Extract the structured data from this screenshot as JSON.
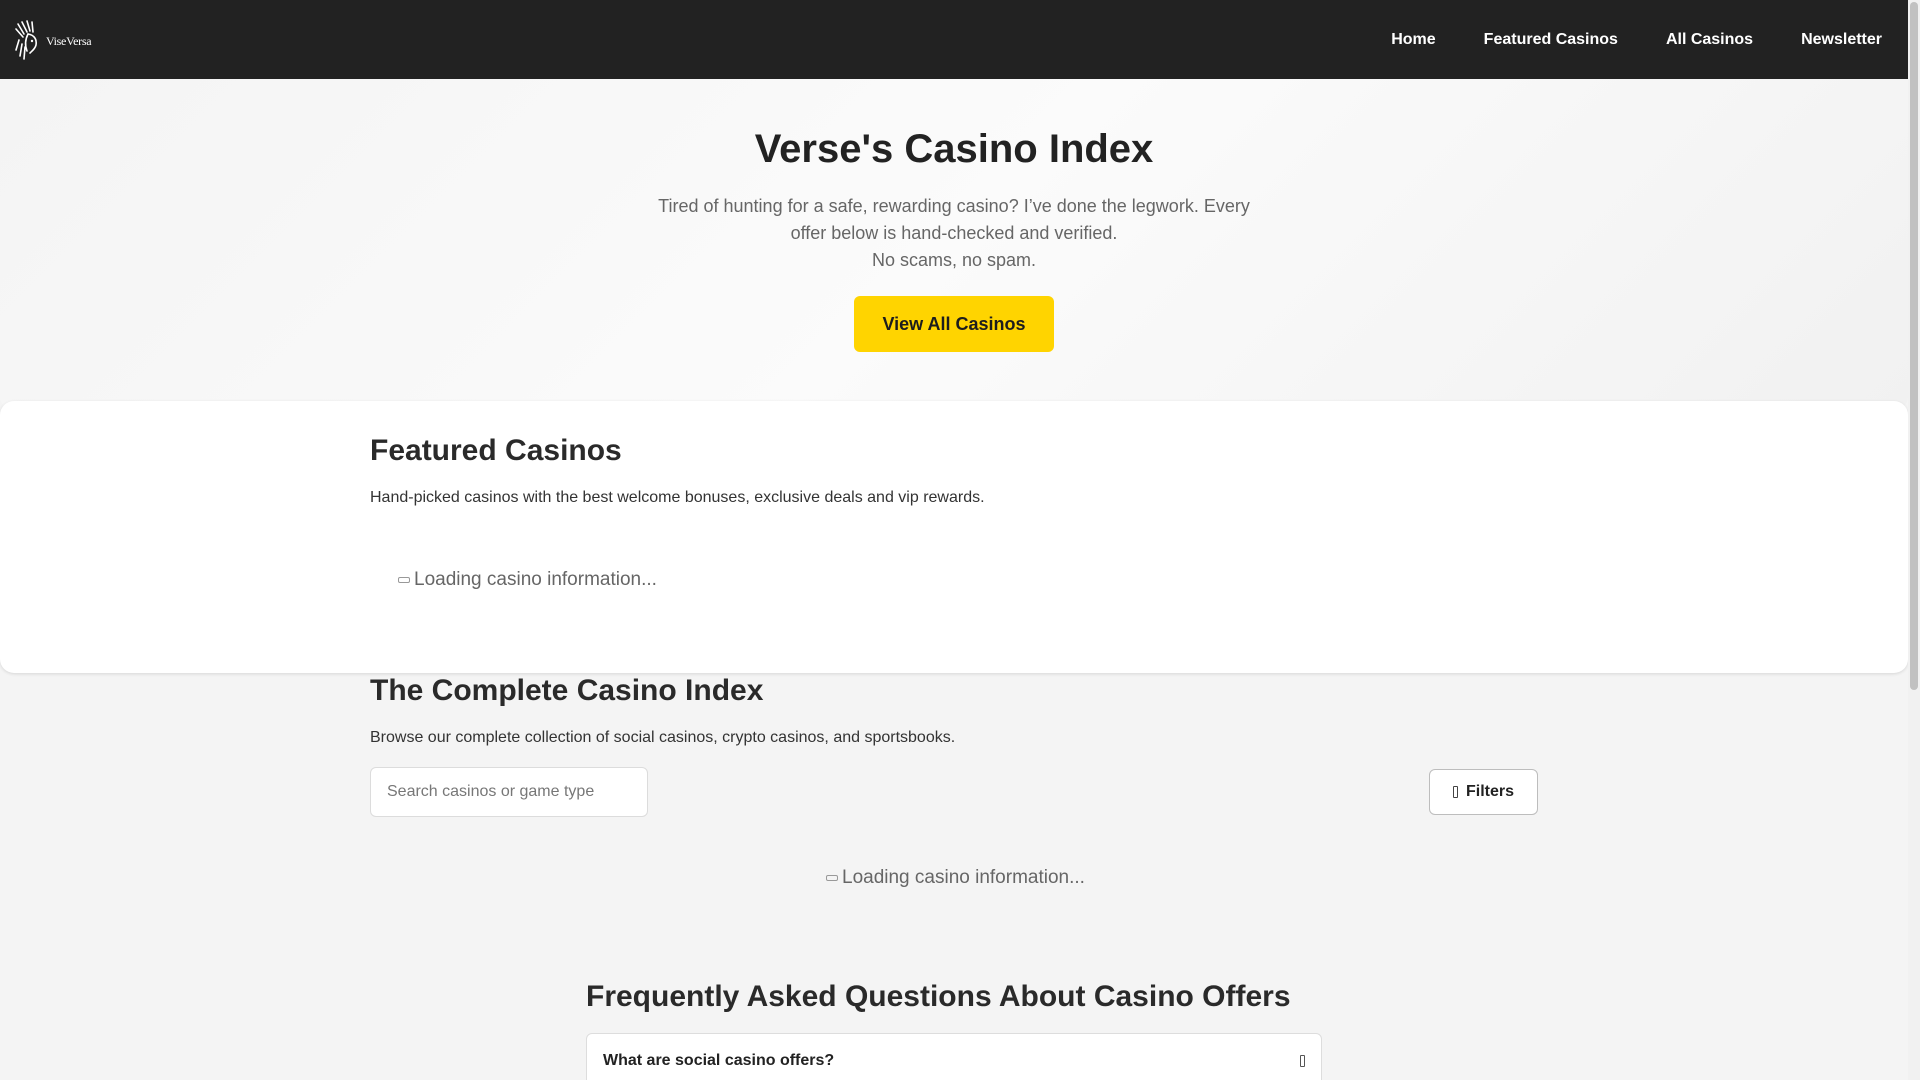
{
  "brand": {
    "logo_text": "ViseVersa"
  },
  "nav": {
    "items": [
      {
        "label": "Home"
      },
      {
        "label": "Featured Casinos"
      },
      {
        "label": "All Casinos"
      },
      {
        "label": "Newsletter"
      }
    ]
  },
  "hero": {
    "title": "Verse's Casino Index",
    "description_line1": "Tired of hunting for a safe, rewarding casino? I’ve done the legwork. Every offer below is hand-checked and verified.",
    "description_line2": "No scams, no spam.",
    "cta_label": "View All Casinos"
  },
  "featured": {
    "title": "Featured Casinos",
    "description": "Hand-picked casinos with the best welcome bonuses, exclusive deals and vip rewards.",
    "loading_text": "Loading casino information..."
  },
  "index": {
    "title": "The Complete Casino Index",
    "description": "Browse our complete collection of social casinos, crypto casinos, and sportsbooks.",
    "search_placeholder": "Search casinos or game type",
    "filters_label": "Filters",
    "loading_text": "Loading casino information..."
  },
  "faq": {
    "title": "Frequently Asked Questions About Casino Offers",
    "items": [
      {
        "question": "What are social casino offers?"
      }
    ]
  },
  "colors": {
    "nav_background": "#222222",
    "accent": "#ffd400",
    "page_background": "#f4f4f4"
  },
  "icons": {
    "logo": "chief-headdress-logo-icon",
    "loading": "spinner-icon",
    "filters": "filter-icon",
    "faq_toggle": "chevron-down-icon"
  }
}
